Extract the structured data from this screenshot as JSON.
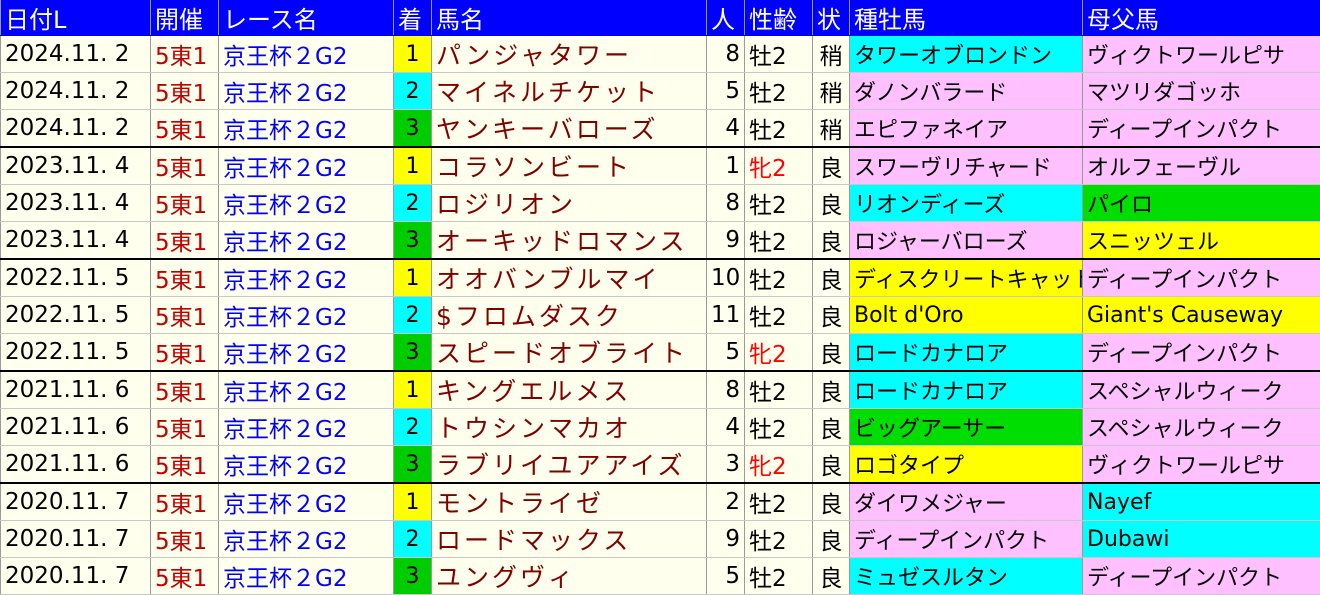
{
  "header": {
    "date": "日付L",
    "venue": "開催",
    "race": "レース名",
    "finish": "着",
    "horse": "馬名",
    "popularity": "人",
    "sex_age": "性齢",
    "track": "状",
    "sire": "種牡馬",
    "dam_sire": "母父馬"
  },
  "colors": {
    "header_bg": "#0000ff",
    "row_bg": "#ffffee",
    "finish_1": "#ffff00",
    "finish_2": "#00ffff",
    "finish_3": "#00cc00",
    "cyan": "#00ffff",
    "pink": "#ffc0ff",
    "yellow": "#ffff00",
    "green": "#00dd00"
  },
  "rows": [
    {
      "date": "2024.11. 2",
      "venue": "5東1",
      "race": "京王杯２G2",
      "finish": "1",
      "horse": "パンジャタワー",
      "popularity": "8",
      "sex_age": "牡2",
      "filly": false,
      "track": "稍",
      "sire": "タワーオブロンドン",
      "sire_color": "cyan",
      "dam_sire": "ヴィクトワールピサ",
      "dam_color": "pink"
    },
    {
      "date": "2024.11. 2",
      "venue": "5東1",
      "race": "京王杯２G2",
      "finish": "2",
      "horse": "マイネルチケット",
      "popularity": "5",
      "sex_age": "牡2",
      "filly": false,
      "track": "稍",
      "sire": "ダノンバラード",
      "sire_color": "pink",
      "dam_sire": "マツリダゴッホ",
      "dam_color": "pink"
    },
    {
      "date": "2024.11. 2",
      "venue": "5東1",
      "race": "京王杯２G2",
      "finish": "3",
      "horse": "ヤンキーバローズ",
      "popularity": "4",
      "sex_age": "牡2",
      "filly": false,
      "track": "稍",
      "sire": "エピファネイア",
      "sire_color": "pink",
      "dam_sire": "ディープインパクト",
      "dam_color": "pink"
    },
    {
      "date": "2023.11. 4",
      "venue": "5東1",
      "race": "京王杯２G2",
      "finish": "1",
      "horse": "コラソンビート",
      "popularity": "1",
      "sex_age": "牝2",
      "filly": true,
      "track": "良",
      "sire": "スワーヴリチャード",
      "sire_color": "pink",
      "dam_sire": "オルフェーヴル",
      "dam_color": "pink"
    },
    {
      "date": "2023.11. 4",
      "venue": "5東1",
      "race": "京王杯２G2",
      "finish": "2",
      "horse": "ロジリオン",
      "popularity": "8",
      "sex_age": "牡2",
      "filly": false,
      "track": "良",
      "sire": "リオンディーズ",
      "sire_color": "cyan",
      "dam_sire": "パイロ",
      "dam_color": "green"
    },
    {
      "date": "2023.11. 4",
      "venue": "5東1",
      "race": "京王杯２G2",
      "finish": "3",
      "horse": "オーキッドロマンス",
      "popularity": "9",
      "sex_age": "牡2",
      "filly": false,
      "track": "良",
      "sire": "ロジャーバローズ",
      "sire_color": "pink",
      "dam_sire": "スニッツェル",
      "dam_color": "yellow"
    },
    {
      "date": "2022.11. 5",
      "venue": "5東1",
      "race": "京王杯２G2",
      "finish": "1",
      "horse": "オオバンブルマイ",
      "popularity": "10",
      "sex_age": "牡2",
      "filly": false,
      "track": "良",
      "sire": "ディスクリートキャット",
      "sire_color": "yellow",
      "dam_sire": "ディープインパクト",
      "dam_color": "pink"
    },
    {
      "date": "2022.11. 5",
      "venue": "5東1",
      "race": "京王杯２G2",
      "finish": "2",
      "horse": "$フロムダスク",
      "popularity": "11",
      "sex_age": "牡2",
      "filly": false,
      "track": "良",
      "sire": "Bolt d'Oro",
      "sire_color": "yellow",
      "dam_sire": "Giant's Causeway",
      "dam_color": "yellow"
    },
    {
      "date": "2022.11. 5",
      "venue": "5東1",
      "race": "京王杯２G2",
      "finish": "3",
      "horse": "スピードオブライト",
      "popularity": "5",
      "sex_age": "牝2",
      "filly": true,
      "track": "良",
      "sire": "ロードカナロア",
      "sire_color": "cyan",
      "dam_sire": "ディープインパクト",
      "dam_color": "pink"
    },
    {
      "date": "2021.11. 6",
      "venue": "5東1",
      "race": "京王杯２G2",
      "finish": "1",
      "horse": "キングエルメス",
      "popularity": "8",
      "sex_age": "牡2",
      "filly": false,
      "track": "良",
      "sire": "ロードカナロア",
      "sire_color": "cyan",
      "dam_sire": "スペシャルウィーク",
      "dam_color": "pink"
    },
    {
      "date": "2021.11. 6",
      "venue": "5東1",
      "race": "京王杯２G2",
      "finish": "2",
      "horse": "トウシンマカオ",
      "popularity": "4",
      "sex_age": "牡2",
      "filly": false,
      "track": "良",
      "sire": "ビッグアーサー",
      "sire_color": "green",
      "dam_sire": "スペシャルウィーク",
      "dam_color": "pink"
    },
    {
      "date": "2021.11. 6",
      "venue": "5東1",
      "race": "京王杯２G2",
      "finish": "3",
      "horse": "ラブリイユアアイズ",
      "popularity": "3",
      "sex_age": "牝2",
      "filly": true,
      "track": "良",
      "sire": "ロゴタイプ",
      "sire_color": "yellow",
      "dam_sire": "ヴィクトワールピサ",
      "dam_color": "pink"
    },
    {
      "date": "2020.11. 7",
      "venue": "5東1",
      "race": "京王杯２G2",
      "finish": "1",
      "horse": "モントライゼ",
      "popularity": "2",
      "sex_age": "牡2",
      "filly": false,
      "track": "良",
      "sire": "ダイワメジャー",
      "sire_color": "pink",
      "dam_sire": "Nayef",
      "dam_color": "cyan"
    },
    {
      "date": "2020.11. 7",
      "venue": "5東1",
      "race": "京王杯２G2",
      "finish": "2",
      "horse": "ロードマックス",
      "popularity": "9",
      "sex_age": "牡2",
      "filly": false,
      "track": "良",
      "sire": "ディープインパクト",
      "sire_color": "pink",
      "dam_sire": "Dubawi",
      "dam_color": "cyan"
    },
    {
      "date": "2020.11. 7",
      "venue": "5東1",
      "race": "京王杯２G2",
      "finish": "3",
      "horse": "ユングヴィ",
      "popularity": "5",
      "sex_age": "牡2",
      "filly": false,
      "track": "良",
      "sire": "ミュゼスルタン",
      "sire_color": "cyan",
      "dam_sire": "ディープインパクト",
      "dam_color": "pink"
    }
  ]
}
